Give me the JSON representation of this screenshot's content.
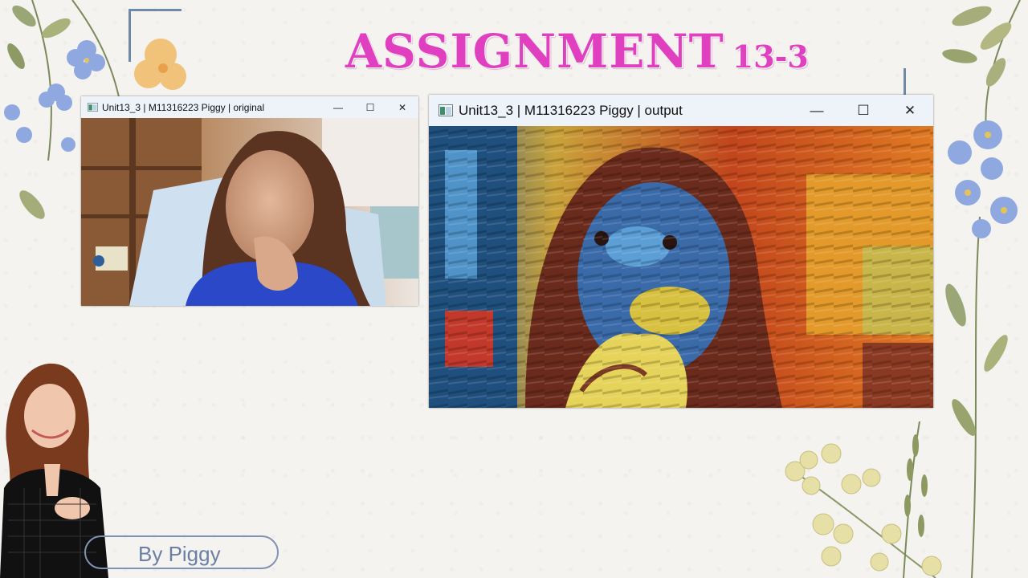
{
  "slide": {
    "title_main": "ASSIGNMENT",
    "title_number": "13-3",
    "author_label": "By Piggy"
  },
  "colors": {
    "title": "#e03fbf",
    "accent_line": "#6f89a8",
    "author_text": "#6b7ea4",
    "titlebar_bg": "#eef2f9"
  },
  "windows": {
    "original": {
      "title": "Unit13_3 | M11316223 Piggy | original",
      "minimize_glyph": "—",
      "maximize_glyph": "☐",
      "close_glyph": "✕"
    },
    "output": {
      "title": "Unit13_3 | M11316223 Piggy | output",
      "minimize_glyph": "—",
      "maximize_glyph": "☐",
      "close_glyph": "✕"
    }
  },
  "icons": [
    "app-window-icon",
    "minimize-icon",
    "maximize-icon",
    "close-icon",
    "flower-decoration-icon"
  ]
}
